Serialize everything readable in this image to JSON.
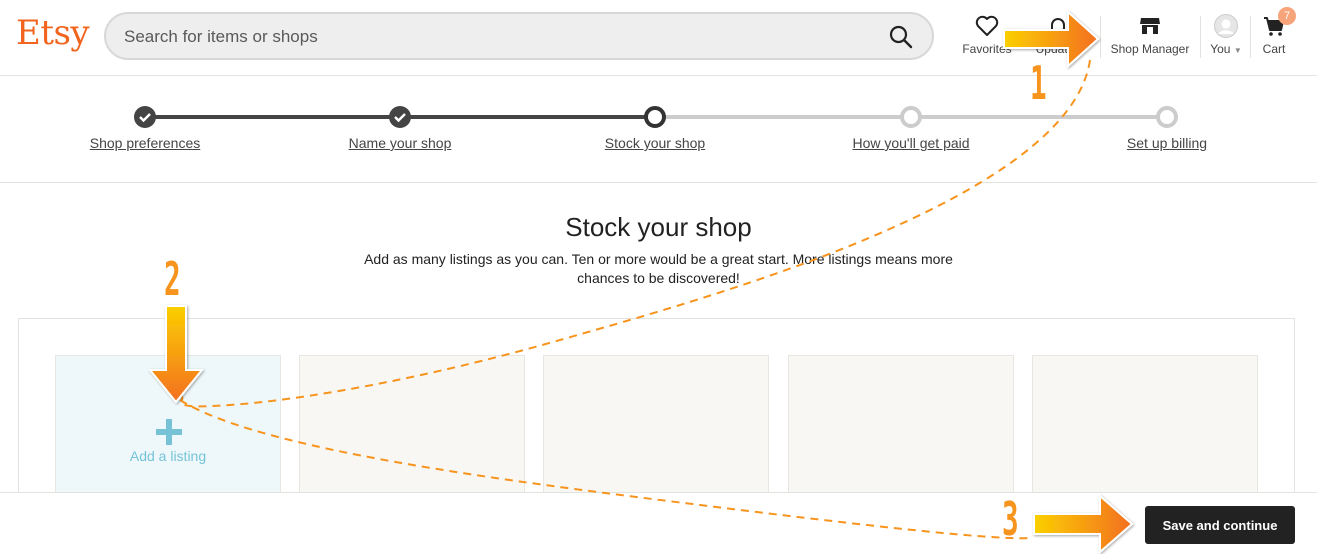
{
  "header": {
    "logo": "Etsy",
    "search_placeholder": "Search for items or shops",
    "nav": {
      "favorites": "Favorites",
      "updates": "Updates",
      "shop_manager": "Shop Manager",
      "you": "You",
      "cart": "Cart",
      "cart_count": "7"
    },
    "icons": {
      "favorites": "heart-icon",
      "updates": "bell-icon",
      "shop_manager": "storefront-icon",
      "you": "avatar-icon",
      "cart": "cart-icon",
      "search": "search-icon"
    }
  },
  "stepper": {
    "steps": [
      {
        "label": "Shop preferences",
        "state": "done"
      },
      {
        "label": "Name your shop",
        "state": "done"
      },
      {
        "label": "Stock your shop",
        "state": "current"
      },
      {
        "label": "How you'll get paid",
        "state": "todo"
      },
      {
        "label": "Set up billing",
        "state": "todo"
      }
    ]
  },
  "main": {
    "title": "Stock your shop",
    "subtitle": "Add as many listings as you can. Ten or more would be a great start. More listings means more chances to be discovered!",
    "add_listing_label": "Add a listing",
    "empty_slots": 4
  },
  "footer": {
    "save_label": "Save and continue"
  },
  "annotations": {
    "numbers": [
      "1",
      "2",
      "3"
    ],
    "color": "#f7941d"
  },
  "colors": {
    "brand": "#f1641e",
    "accent_add": "#76c3d8",
    "primary_button": "#222222"
  }
}
